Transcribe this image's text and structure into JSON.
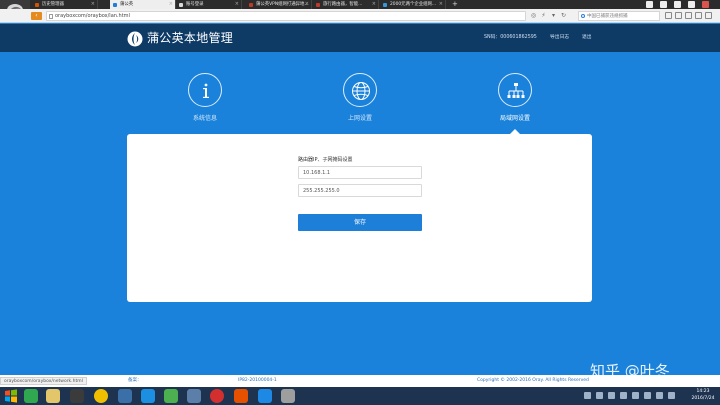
{
  "browser": {
    "tabs": [
      {
        "label": "历史管理器",
        "active": false,
        "favicon_color": "#d35400"
      },
      {
        "label": "蒲公英",
        "active": true,
        "favicon_color": "#1f7fd8"
      },
      {
        "label": "账号登录",
        "active": false,
        "favicon_color": "#d9d9d9"
      },
      {
        "label": "蒲公英VPN组网打通异地...",
        "active": false,
        "favicon_color": "#c0392b"
      },
      {
        "label": "旅行路由器，智能...",
        "active": false,
        "favicon_color": "#c0392b"
      },
      {
        "label": "2000元两个企业组网...",
        "active": false,
        "favicon_color": "#3498db"
      }
    ],
    "new_tab": "+",
    "url": "orayboxcom/oraybox/lan.html",
    "search_placeholder": "中国已捕获违规抓捕",
    "icons": [
      "back-icon",
      "page-icon",
      "search-icon"
    ]
  },
  "header": {
    "title": "蒲公英本地管理",
    "sn": "SN码：000601862595",
    "export_log": "导出日志",
    "logout": "退出"
  },
  "nav": {
    "items": [
      {
        "label": "系统信息",
        "icon": "info-icon",
        "active": false
      },
      {
        "label": "上网设置",
        "icon": "globe-icon",
        "active": false
      },
      {
        "label": "局域网设置",
        "icon": "network-icon",
        "active": true
      }
    ]
  },
  "form": {
    "section_label": "路由器IP、子网掩码设置",
    "ip_value": "10.168.1.1",
    "mask_value": "255.255.255.0",
    "save_label": "保存"
  },
  "footer": {
    "status_url": "orayboxcom/oraybox/network.html",
    "beian": "备案：",
    "icp": "IP82-20100004-1",
    "copyright": "Copyright © 2002-2016 Oray. All Rights Reserved"
  },
  "watermark": "知乎 @叶冬",
  "taskbar": {
    "time": "14:23",
    "date": "2016/7/24",
    "apps": [
      {
        "icon": "ie-icon",
        "color": "#2fa84f"
      },
      {
        "icon": "folder-icon",
        "color": "#e3c56a"
      },
      {
        "icon": "media-icon",
        "color": "#3b3b3b"
      },
      {
        "icon": "chrome-icon",
        "color": "#f0c000"
      },
      {
        "icon": "qq-icon",
        "color": "#3a6fa8"
      },
      {
        "icon": "cloud-icon",
        "color": "#1d8fe0"
      },
      {
        "icon": "bird-icon",
        "color": "#4caf50"
      },
      {
        "icon": "video-icon",
        "color": "#d32f2f"
      },
      {
        "icon": "paint-icon",
        "color": "#e65100"
      },
      {
        "icon": "wangwang-icon",
        "color": "#1e88e5"
      },
      {
        "icon": "tool-icon",
        "color": "#9e9e9e"
      }
    ]
  },
  "colors": {
    "primary": "#1a82da",
    "header_bg": "#0e3a66",
    "button": "#1d7fd8"
  }
}
